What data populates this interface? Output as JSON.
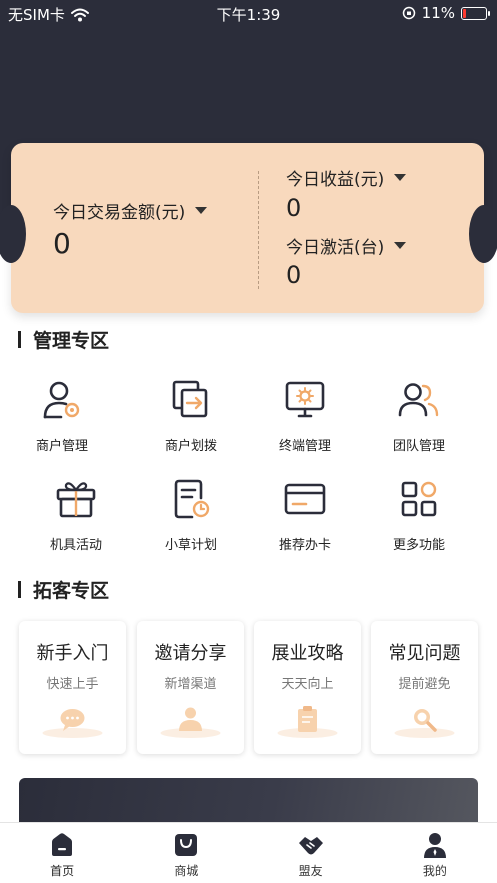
{
  "status_bar": {
    "carrier": "无SIM卡",
    "time": "下午1:39",
    "battery": "11%"
  },
  "stats": {
    "daily_volume_label": "今日交易金额(元)",
    "daily_volume_value": "0",
    "daily_income_label": "今日收益(元)",
    "daily_income_value": "0",
    "daily_activation_label": "今日激活(台)",
    "daily_activation_value": "0"
  },
  "management": {
    "title": "管理专区",
    "items": [
      {
        "label": "商户管理",
        "icon": "merchant-manage-icon"
      },
      {
        "label": "商户划拨",
        "icon": "merchant-transfer-icon"
      },
      {
        "label": "终端管理",
        "icon": "terminal-manage-icon"
      },
      {
        "label": "团队管理",
        "icon": "team-manage-icon"
      },
      {
        "label": "机具活动",
        "icon": "device-activity-icon"
      },
      {
        "label": "小草计划",
        "icon": "plan-icon"
      },
      {
        "label": "推荐办卡",
        "icon": "card-recommend-icon"
      },
      {
        "label": "更多功能",
        "icon": "more-functions-icon"
      }
    ]
  },
  "expansion": {
    "title": "拓客专区",
    "cards": [
      {
        "title": "新手入门",
        "subtitle": "快速上手"
      },
      {
        "title": "邀请分享",
        "subtitle": "新增渠道"
      },
      {
        "title": "展业攻略",
        "subtitle": "天天向上"
      },
      {
        "title": "常见问题",
        "subtitle": "提前避免"
      }
    ]
  },
  "tabbar": {
    "tabs": [
      {
        "label": "首页",
        "icon": "home-icon"
      },
      {
        "label": "商城",
        "icon": "shop-bag-icon"
      },
      {
        "label": "盟友",
        "icon": "handshake-icon"
      },
      {
        "label": "我的",
        "icon": "profile-icon"
      }
    ],
    "active": 0
  },
  "colors": {
    "header": "#2b2d3a",
    "card": "#f8d9bd",
    "accent": "#f0a868"
  }
}
